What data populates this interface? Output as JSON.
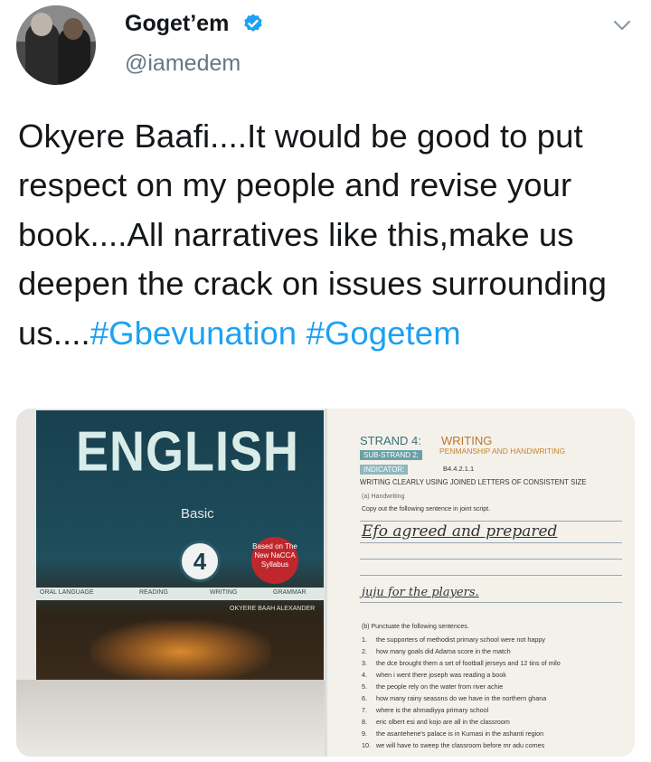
{
  "user": {
    "display_name": "Goget’em",
    "handle": "@iamedem"
  },
  "tweet": {
    "text": "Okyere Baafi....It would be good to put respect on my people and revise your book....All narratives like this,make us deepen the crack on issues surrounding us....",
    "hashtags": [
      "#Gbevunation",
      "#Gogetem"
    ]
  },
  "colors": {
    "accent": "#1da1f2",
    "verified": "#1da1f2",
    "secondary_text": "#657786"
  },
  "icons": [
    "verified-icon",
    "chevron-down-icon"
  ],
  "media": {
    "book": {
      "title": "ENGLISH",
      "level": "Basic",
      "number": "4",
      "seal": "Based on The New NaCCA Syllabus",
      "strands": [
        "ORAL LANGUAGE",
        "READING",
        "WRITING",
        "GRAMMAR"
      ],
      "author": "OKYERE BAAH ALEXANDER"
    },
    "page": {
      "strand": "STRAND 4:",
      "strand_name": "WRITING",
      "sub_strand": "SUB-STRAND 2:",
      "sub_strand_name": "PENMANSHIP AND HANDWRITING",
      "indicator": "INDICATOR:",
      "indicator_code": "B4.4.2.1.1",
      "indicator_text": "WRITING CLEARLY USING JOINED LETTERS OF CONSISTENT SIZE",
      "part_a": "(a)  Handwriting",
      "instruction_a": "Copy out the following sentence in joint script.",
      "script_line_1": "Efo agreed and prepared",
      "script_line_2": "juju for the players.",
      "part_b": "(b)  Punctuate the following sentences.",
      "sentences": [
        {
          "num": "1.",
          "text": "the supporters of methodist primary school were not happy"
        },
        {
          "num": "2.",
          "text": "how many goals did Adama score in the match"
        },
        {
          "num": "3.",
          "text": "the dce brought them a set of football jerseys and 12 tins of milo"
        },
        {
          "num": "4.",
          "text": "when i went there joseph was reading a book"
        },
        {
          "num": "5.",
          "text": "the people rely on the water from river achie"
        },
        {
          "num": "6.",
          "text": "how many rainy seasons do we have in the northern ghana"
        },
        {
          "num": "7.",
          "text": "where is the ahmadiyya primary school"
        },
        {
          "num": "8.",
          "text": "eric olbert esi and kojo are all in the classroom"
        },
        {
          "num": "9.",
          "text": "the asantehene's palace is in Kumasi in the ashanti region"
        },
        {
          "num": "10.",
          "text": "we will have to sweep the classroom before mr adu comes"
        }
      ]
    }
  }
}
